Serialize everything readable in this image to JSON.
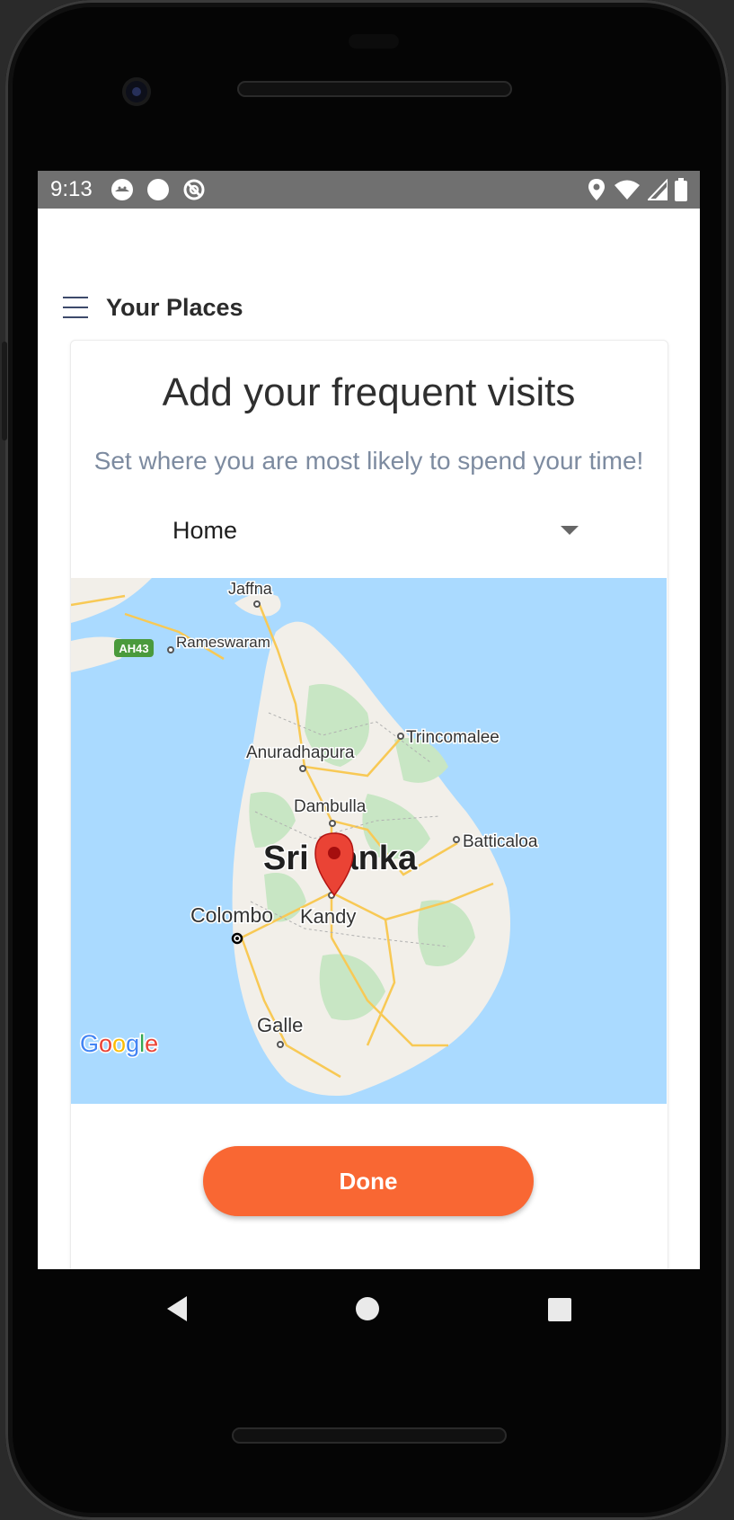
{
  "status_bar": {
    "time": "9:13",
    "left_icons": [
      "android-icon",
      "record-icon",
      "no-disturb-icon"
    ],
    "right_icons": [
      "location-icon",
      "wifi-icon",
      "signal-icon",
      "battery-icon"
    ]
  },
  "app_bar": {
    "menu_icon": "hamburger-menu-icon",
    "title": "Your Places"
  },
  "card": {
    "title": "Add your frequent visits",
    "subtitle": "Set where you are most likely to spend your time!",
    "place_type": {
      "selected": "Home"
    }
  },
  "map": {
    "country_label": "Sri Lanka",
    "cities": [
      "Jaffna",
      "Rameswaram",
      "Trincomalee",
      "Anuradhapura",
      "Dambulla",
      "Batticaloa",
      "Colombo",
      "Kandy",
      "Galle"
    ],
    "road_shield": "AH43",
    "logo": "Google",
    "marker_icon": "map-pin-icon",
    "colors": {
      "water": "#aadaff",
      "land": "#f2efe9",
      "park": "#c8e6c4",
      "road": "#f8c955",
      "marker": "#ea4335"
    }
  },
  "actions": {
    "done_label": "Done"
  },
  "colors": {
    "accent": "#f96733",
    "subtitle": "#7d8ba0",
    "status_bar": "#707070"
  },
  "nav_bar": {
    "buttons": [
      "back-icon",
      "home-icon",
      "recents-icon"
    ]
  }
}
